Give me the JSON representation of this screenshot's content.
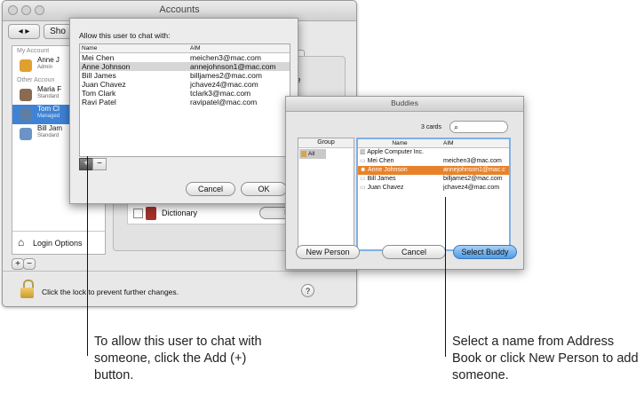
{
  "accounts_window": {
    "title": "Accounts",
    "show_all_label": "Sho",
    "sidebar": {
      "my_account_header": "My Account",
      "other_accounts_header": "Other Accoun",
      "users": [
        {
          "name": "Anne J",
          "role": "Admin",
          "color": "#e0a030"
        },
        {
          "name": "Maria F",
          "role": "Standard",
          "color": "#8a6a50"
        },
        {
          "name": "Tom Cl",
          "role": "Managed",
          "color": "#5c7fa3"
        },
        {
          "name": "Bill Jam",
          "role": "Standard",
          "color": "#6a94c8"
        }
      ],
      "selected_index": 2
    },
    "tab_fragment": "s",
    "side_text_fragment": "se",
    "dictionary_label": "Dictionary",
    "dictionary_button_fragment": "R",
    "login_options_label": "Login Options",
    "add_label": "+",
    "remove_label": "−",
    "lock_text": "Click the lock to prevent further changes.",
    "help_label": "?"
  },
  "chat_sheet": {
    "prompt": "Allow this user to chat with:",
    "columns": [
      "Name",
      "AIM"
    ],
    "rows": [
      {
        "name": "Mei Chen",
        "aim": "meichen3@mac.com"
      },
      {
        "name": "Anne Johnson",
        "aim": "annejohnson1@mac.com"
      },
      {
        "name": "Bill James",
        "aim": "billjames2@mac.com"
      },
      {
        "name": "Juan Chavez",
        "aim": "jchavez4@mac.com"
      },
      {
        "name": "Tom Clark",
        "aim": "tclark3@mac.com"
      },
      {
        "name": "Ravi Patel",
        "aim": "ravipatel@mac.com"
      }
    ],
    "selected_index": 1,
    "add_label": "+",
    "remove_label": "−",
    "cancel_label": "Cancel",
    "ok_label": "OK"
  },
  "buddies_window": {
    "title": "Buddies",
    "card_count": "3 cards",
    "search_icon": "magnifier-icon",
    "group_header": "Group",
    "group_items": [
      "All"
    ],
    "name_header": "Name",
    "aim_header": "AIM",
    "rows": [
      {
        "name": "Apple Computer Inc.",
        "aim": ""
      },
      {
        "name": "Mei Chen",
        "aim": "meichen3@mac.com"
      },
      {
        "name": "Anne Johnson",
        "aim": "annejohnson1@mac.c"
      },
      {
        "name": "Bill James",
        "aim": "billjames2@mac.com"
      },
      {
        "name": "Juan Chavez",
        "aim": "jchavez4@mac.com"
      }
    ],
    "selected_index": 2,
    "selection_color": "#e8822a",
    "new_person_label": "New Person",
    "cancel_label": "Cancel",
    "select_buddy_label": "Select Buddy"
  },
  "callouts": {
    "add_note": "To allow this user to chat with someone, click the Add (+) button.",
    "select_note": "Select a name from Address Book or click New Person to add someone."
  }
}
